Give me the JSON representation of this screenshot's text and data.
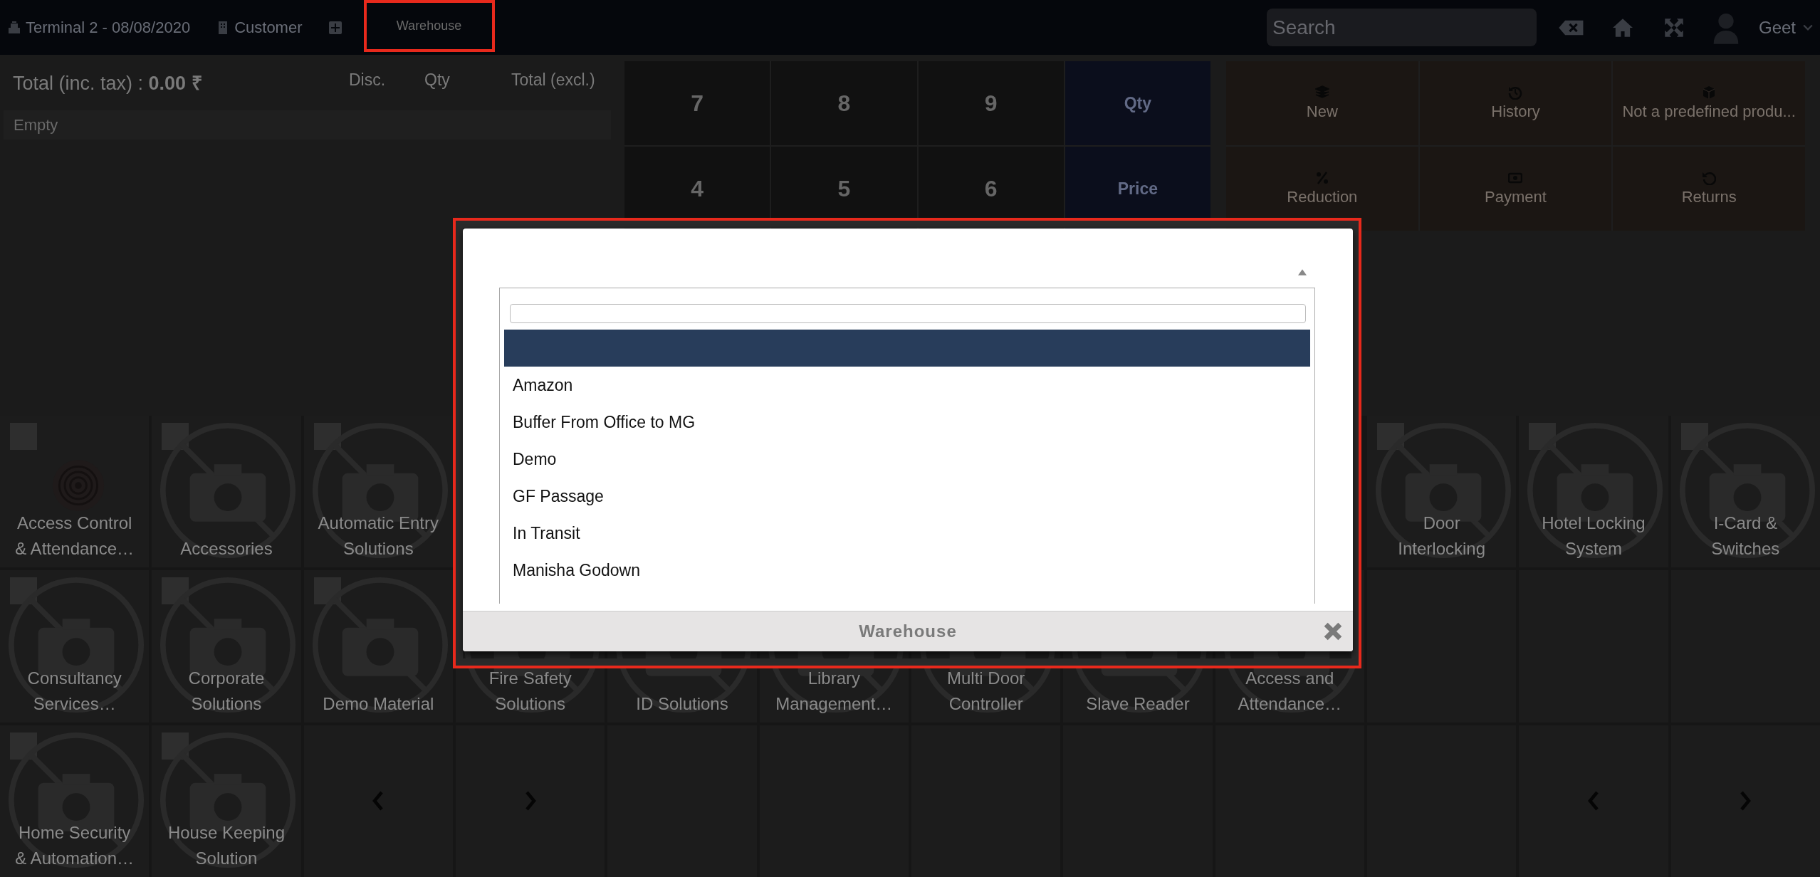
{
  "top_bar": {
    "terminal": "Terminal 2 - 08/08/2020",
    "customer": "Customer",
    "warehouse_button": {
      "label": "Warehouse",
      "highlighted": true
    },
    "search": {
      "placeholder": "Search"
    },
    "user": "Geet"
  },
  "order": {
    "total_label": "Total (inc. tax) : **0.00 ₹**",
    "columns": [
      "Disc.",
      "Qty",
      "Total (excl.)"
    ],
    "empty": "Empty"
  },
  "numpad": [
    {
      "label": "7",
      "kind": "digit"
    },
    {
      "label": "8",
      "kind": "digit"
    },
    {
      "label": "9",
      "kind": "digit"
    },
    {
      "label": "Qty",
      "kind": "mode"
    },
    {
      "label": "4",
      "kind": "digit"
    },
    {
      "label": "5",
      "kind": "digit"
    },
    {
      "label": "6",
      "kind": "digit"
    },
    {
      "label": "Price",
      "kind": "mode"
    }
  ],
  "actions": [
    {
      "label": "New"
    },
    {
      "label": "History"
    },
    {
      "label": "Not a predefined produ..."
    },
    {
      "label": "Reduction"
    },
    {
      "label": "Payment"
    },
    {
      "label": "Returns"
    }
  ],
  "categories": [
    [
      {
        "kind": "category",
        "name": "Access Control & Attendance…",
        "has_image": true
      },
      {
        "kind": "category",
        "name": "Accessories",
        "has_image": false
      },
      {
        "kind": "category",
        "name": "Automatic Entry Solutions",
        "has_image": false
      },
      {
        "kind": "category",
        "name": "Door Interlocking",
        "has_image": false
      },
      {
        "kind": "category",
        "name": "Hotel Locking System",
        "has_image": false
      },
      {
        "kind": "category",
        "name": "I-Card & Switches",
        "has_image": false
      }
    ],
    [
      {
        "kind": "category",
        "name": "Consultancy Services…",
        "has_image": false
      },
      {
        "kind": "category",
        "name": "Corporate Solutions",
        "has_image": false
      },
      {
        "kind": "category",
        "name": "Demo Material",
        "has_image": false
      },
      {
        "kind": "category",
        "name": "Fire Safety Solutions",
        "has_image": false
      },
      {
        "kind": "category",
        "name": "ID Solutions",
        "has_image": false
      },
      {
        "kind": "category",
        "name": "Library Management…",
        "has_image": false
      },
      {
        "kind": "category",
        "name": "Multi Door Controller",
        "has_image": false
      },
      {
        "kind": "category",
        "name": "Slave Reader",
        "has_image": false
      },
      {
        "kind": "category",
        "name": "Access and Attendance…",
        "has_image": false
      },
      {
        "kind": "empty"
      },
      {
        "kind": "empty"
      },
      {
        "kind": "empty"
      }
    ],
    [
      {
        "kind": "category",
        "name": "Home Security & Automation…",
        "has_image": false
      },
      {
        "kind": "category",
        "name": "House Keeping Solution",
        "has_image": false
      },
      {
        "kind": "prev"
      },
      {
        "kind": "next"
      },
      {
        "kind": "empty"
      },
      {
        "kind": "empty"
      },
      {
        "kind": "empty"
      },
      {
        "kind": "empty"
      },
      {
        "kind": "empty"
      },
      {
        "kind": "empty"
      },
      {
        "kind": "prev"
      },
      {
        "kind": "next"
      }
    ]
  ],
  "modal": {
    "title": "Warehouse",
    "highlighted": true,
    "options": [
      {
        "selected": true
      },
      {
        "label": "Amazon",
        "selected": false
      },
      {
        "label": "Buffer From Office to MG",
        "selected": false
      },
      {
        "label": "Demo",
        "selected": false
      },
      {
        "label": "GF Passage",
        "selected": false
      },
      {
        "label": "In Transit",
        "selected": false
      },
      {
        "label": "Manisha Godown",
        "selected": false
      }
    ]
  }
}
